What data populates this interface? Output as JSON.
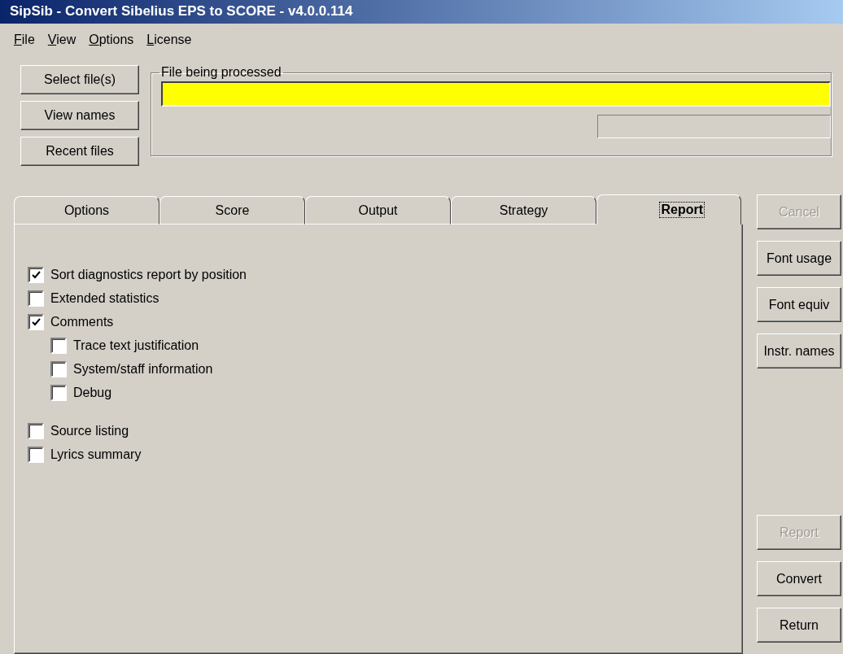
{
  "window": {
    "title": "SipSib - Convert Sibelius EPS to SCORE - v4.0.0.114"
  },
  "menu": [
    "File",
    "View",
    "Options",
    "License"
  ],
  "file_buttons": [
    {
      "label": "Select file(s)",
      "disabled": false
    },
    {
      "label": "View names",
      "disabled": false
    },
    {
      "label": "Recent files",
      "disabled": false
    }
  ],
  "processing": {
    "title": "File being processed"
  },
  "tabs": [
    {
      "label": "Options",
      "selected": false
    },
    {
      "label": "Score",
      "selected": false
    },
    {
      "label": "Output",
      "selected": false
    },
    {
      "label": "Strategy",
      "selected": false
    },
    {
      "label": "Report",
      "selected": true
    }
  ],
  "option_groups": [
    {
      "options": [
        {
          "label": "Sort diagnostics report by position",
          "checked": true
        },
        {
          "label": "Extended statistics",
          "checked": false
        },
        {
          "label": "Comments",
          "checked": true,
          "children": [
            {
              "label": "Trace text justification",
              "checked": false
            },
            {
              "label": "System/staff information",
              "checked": false
            },
            {
              "label": "Debug",
              "checked": false
            }
          ]
        }
      ]
    },
    {
      "options": [
        {
          "label": "Source listing",
          "checked": false
        },
        {
          "label": "Lyrics summary",
          "checked": false
        }
      ]
    }
  ],
  "side_buttons_top": [
    {
      "label": "Cancel",
      "disabled": true
    },
    {
      "label": "Font usage",
      "disabled": false
    },
    {
      "label": "Font equiv",
      "disabled": false
    },
    {
      "label": "Instr. names",
      "disabled": false
    }
  ],
  "side_buttons_bottom": [
    {
      "label": "Report",
      "disabled": true
    },
    {
      "label": "Convert",
      "disabled": false
    },
    {
      "label": "Return",
      "disabled": false
    }
  ]
}
